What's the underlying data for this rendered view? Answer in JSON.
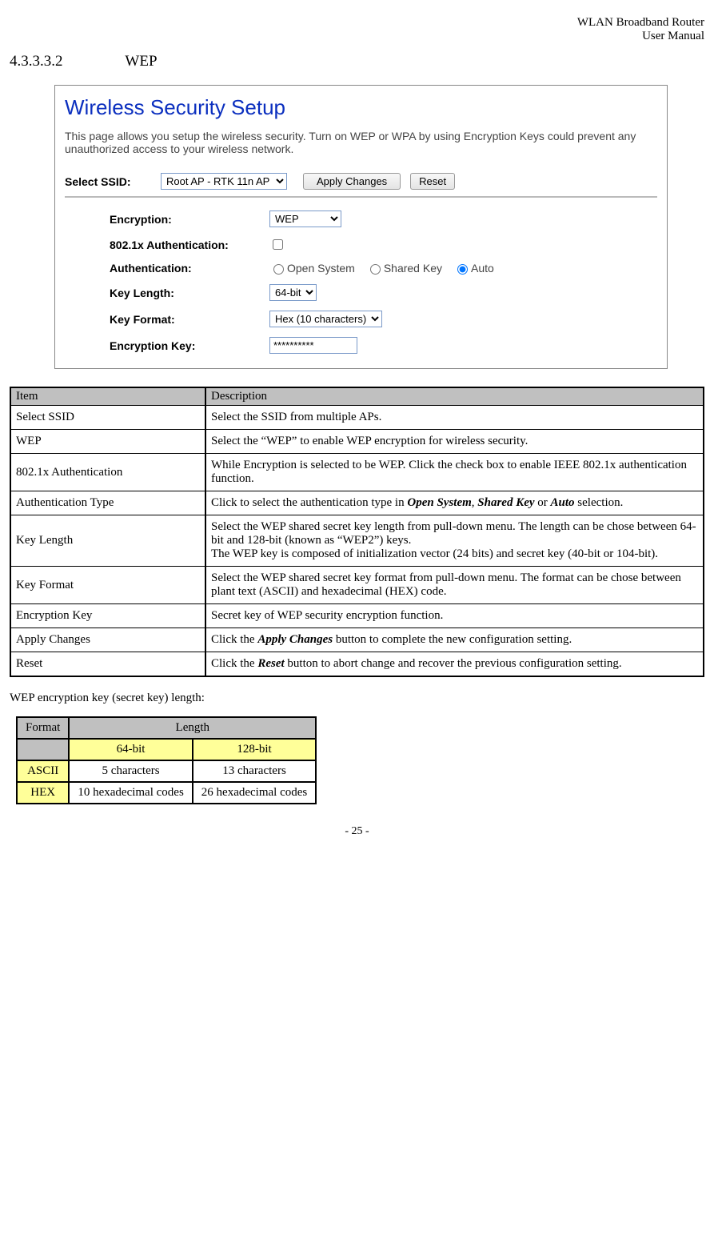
{
  "header": {
    "product": "WLAN  Broadband  Router",
    "manual": "User  Manual"
  },
  "section": {
    "num": "4.3.3.3.2",
    "title": "WEP"
  },
  "screenshot": {
    "title": "Wireless Security Setup",
    "desc": "This page allows you setup the wireless security. Turn on WEP or WPA by using Encryption Keys could prevent any unauthorized access to your wireless network.",
    "select_ssid_label": "Select SSID:",
    "ssid_value": "Root AP - RTK 11n AP",
    "apply_btn": "Apply Changes",
    "reset_btn": "Reset",
    "fields": {
      "encryption_label": "Encryption:",
      "encryption_value": "WEP",
      "auth8021x_label": "802.1x  Authentication:",
      "auth_label": "Authentication:",
      "auth_opt1": "Open System",
      "auth_opt2": "Shared Key",
      "auth_opt3": "Auto",
      "keylen_label": "Key  Length:",
      "keylen_value": "64-bit",
      "keyfmt_label": "Key  Format:",
      "keyfmt_value": "Hex (10 characters)",
      "enckey_label": "Encryption  Key:",
      "enckey_value": "**********"
    }
  },
  "desc_table": {
    "h1": "Item",
    "h2": "Description",
    "rows": [
      {
        "item": "Select SSID",
        "desc": "Select the SSID from multiple APs."
      },
      {
        "item": "WEP",
        "desc": "Select the “WEP” to enable WEP encryption for wireless security."
      },
      {
        "item": "802.1x Authentication",
        "desc": "While Encryption is selected to be WEP. Click the check box to enable IEEE 802.1x authentication function."
      },
      {
        "item": " Authentication Type",
        "desc_pre": " Click to select the authentication type in ",
        "b1": "Open System",
        "mid1": ", ",
        "b2": "Shared Key",
        "mid2": " or ",
        "b3": "Auto",
        "desc_post": " selection."
      },
      {
        "item": "Key Length",
        "desc": "Select the WEP shared secret key length from pull-down menu. The length can be chose between 64-bit and 128-bit (known as “WEP2”) keys.\nThe WEP key is composed of initialization vector (24 bits) and secret key (40-bit or 104-bit)."
      },
      {
        "item": "Key Format",
        "desc": "Select the WEP shared secret key format from pull-down menu. The format can be chose between plant text (ASCII) and hexadecimal (HEX) code."
      },
      {
        "item": "Encryption Key",
        "desc": "Secret key of WEP security encryption function."
      },
      {
        "item": "Apply Changes",
        "desc_pre": "Click the ",
        "b1": "Apply Changes",
        "desc_post": " button to complete the new configuration setting."
      },
      {
        "item": "Reset",
        "desc_pre": "Click the ",
        "b1": "Reset",
        "desc_post": " button to abort change and recover the previous configuration setting."
      }
    ]
  },
  "note": "WEP encryption key (secret key) length:",
  "len_table": {
    "h_format": "Format",
    "h_length": "Length",
    "h_64": "64-bit",
    "h_128": "128-bit",
    "r_ascii": "ASCII",
    "v_ascii_64": "5 characters",
    "v_ascii_128": "13 characters",
    "r_hex": "HEX",
    "v_hex_64": "10 hexadecimal codes",
    "v_hex_128": "26 hexadecimal codes"
  },
  "footer": "- 25 -"
}
